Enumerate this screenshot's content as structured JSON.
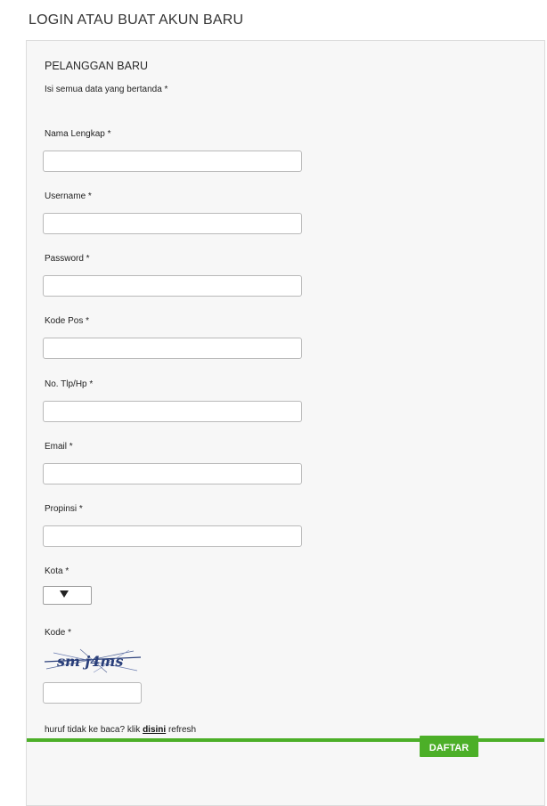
{
  "page": {
    "heading": "LOGIN ATAU BUAT AKUN BARU"
  },
  "form": {
    "title": "PELANGGAN BARU",
    "note": "Isi semua data yang bertanda *",
    "fields": {
      "nama_lengkap": {
        "label": "Nama Lengkap *",
        "value": "",
        "placeholder": ""
      },
      "username": {
        "label": "Username *",
        "value": "",
        "placeholder": ""
      },
      "password": {
        "label": "Password *",
        "value": "",
        "placeholder": ""
      },
      "kode_pos": {
        "label": "Kode Pos *",
        "value": "",
        "placeholder": ""
      },
      "no_telp": {
        "label": "No. Tlp/Hp *",
        "value": "",
        "placeholder": ""
      },
      "email": {
        "label": "Email *",
        "value": "",
        "placeholder": ""
      },
      "propinsi": {
        "label": "Propinsi *",
        "value": "",
        "placeholder": ""
      },
      "kota": {
        "label": "Kota *",
        "selected": ""
      },
      "kode": {
        "label": "Kode *",
        "value": "",
        "placeholder": ""
      }
    },
    "captcha": {
      "text": "sm j4ms"
    },
    "refresh": {
      "prefix": "huruf tidak ke baca? klik ",
      "link": "disini",
      "suffix": " refresh"
    },
    "submit": {
      "label": "DAFTAR"
    }
  },
  "colors": {
    "accent": "#4caf28",
    "panel_background": "#f7f7f7",
    "captcha_ink": "#2a3f7a"
  },
  "icons": {
    "select_arrow": "chevron-down-icon"
  }
}
